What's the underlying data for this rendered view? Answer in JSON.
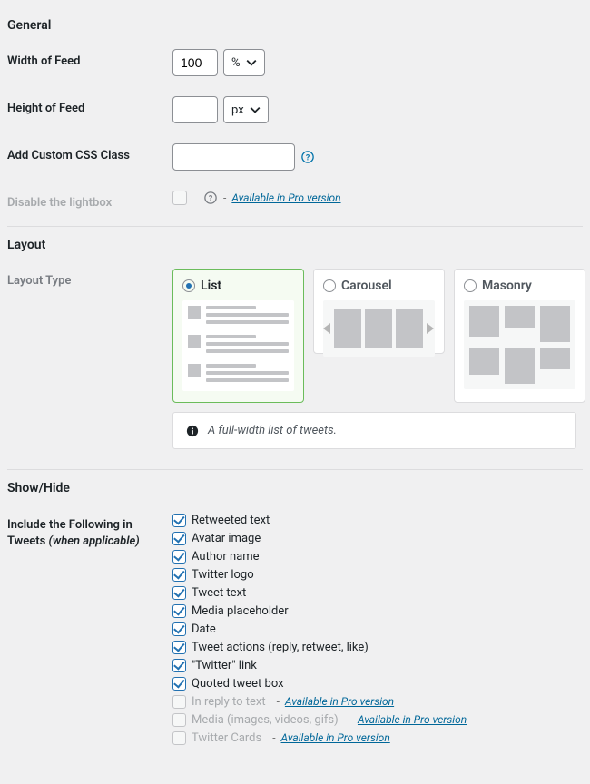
{
  "general": {
    "title": "General",
    "width_label": "Width of Feed",
    "width_value": "100",
    "width_unit": "%",
    "height_label": "Height of Feed",
    "height_value": "",
    "height_unit": "px",
    "css_label": "Add Custom CSS Class",
    "css_value": "",
    "lightbox_label": "Disable the lightbox",
    "pro_link": "Available in Pro version",
    "dash": "- "
  },
  "layout": {
    "title": "Layout",
    "type_label": "Layout Type",
    "options": {
      "list": "List",
      "carousel": "Carousel",
      "masonry": "Masonry"
    },
    "desc": "A full-width list of tweets."
  },
  "showhide": {
    "title": "Show/Hide",
    "include_label_1": "Include the Following in",
    "include_label_2": "Tweets ",
    "include_label_3": "(when applicable)",
    "items": [
      {
        "label": "Retweeted text",
        "checked": true,
        "disabled": false
      },
      {
        "label": "Avatar image",
        "checked": true,
        "disabled": false
      },
      {
        "label": "Author name",
        "checked": true,
        "disabled": false
      },
      {
        "label": "Twitter logo",
        "checked": true,
        "disabled": false
      },
      {
        "label": "Tweet text",
        "checked": true,
        "disabled": false
      },
      {
        "label": "Media placeholder",
        "checked": true,
        "disabled": false
      },
      {
        "label": "Date",
        "checked": true,
        "disabled": false
      },
      {
        "label": "Tweet actions (reply, retweet, like)",
        "checked": true,
        "disabled": false
      },
      {
        "label": "\"Twitter\" link",
        "checked": true,
        "disabled": false
      },
      {
        "label": "Quoted tweet box",
        "checked": true,
        "disabled": false
      },
      {
        "label": "In reply to text",
        "checked": false,
        "disabled": true
      },
      {
        "label": "Media (images, videos, gifs)",
        "checked": false,
        "disabled": true
      },
      {
        "label": "Twitter Cards",
        "checked": false,
        "disabled": true
      }
    ]
  }
}
